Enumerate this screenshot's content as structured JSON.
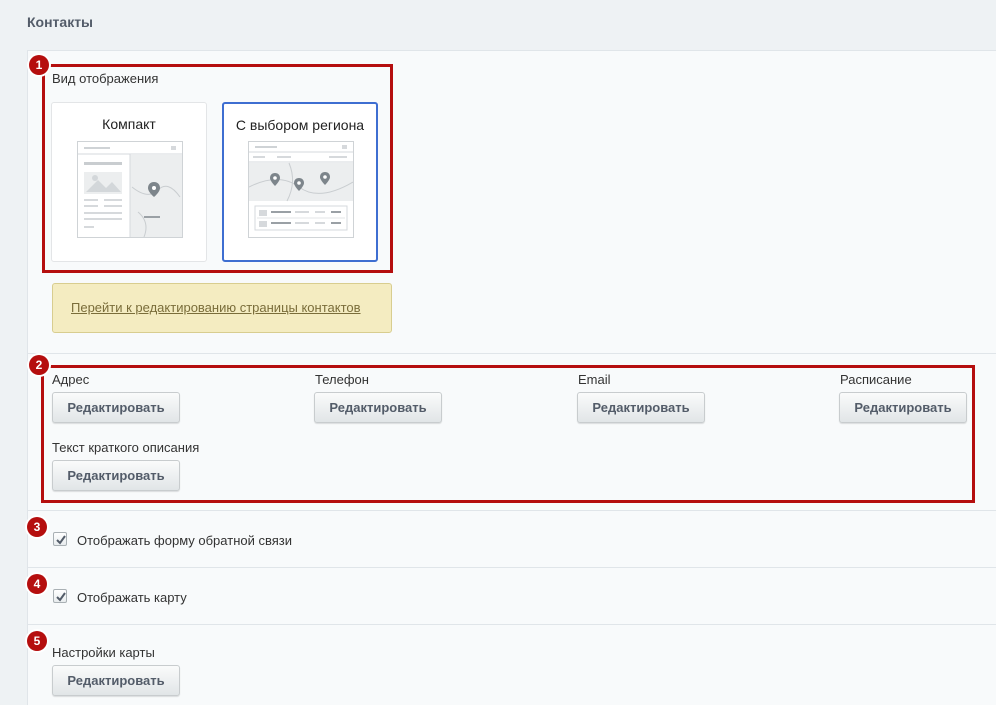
{
  "page": {
    "title": "Контакты"
  },
  "view": {
    "label": "Вид отображения",
    "options": [
      {
        "title": "Компакт"
      },
      {
        "title": "С выбором региона"
      }
    ]
  },
  "edit_page_link": "Перейти к редактированию страницы контактов",
  "fields": {
    "address": {
      "label": "Адрес",
      "button": "Редактировать"
    },
    "phone": {
      "label": "Телефон",
      "button": "Редактировать"
    },
    "email": {
      "label": "Email",
      "button": "Редактировать"
    },
    "schedule": {
      "label": "Расписание",
      "button": "Редактировать"
    },
    "short_description": {
      "label": "Текст краткого описания",
      "button": "Редактировать"
    }
  },
  "feedback_checkbox": {
    "label": "Отображать форму обратной связи",
    "checked": true
  },
  "map_checkbox": {
    "label": "Отображать карту",
    "checked": true
  },
  "map_settings": {
    "label": "Настройки карты",
    "button": "Редактировать"
  },
  "badges": [
    "1",
    "2",
    "3",
    "4",
    "5"
  ],
  "colors": {
    "annotation": "#b50e0e",
    "selected_border": "#3e6ed1",
    "link_box": "#f4ecc1"
  }
}
